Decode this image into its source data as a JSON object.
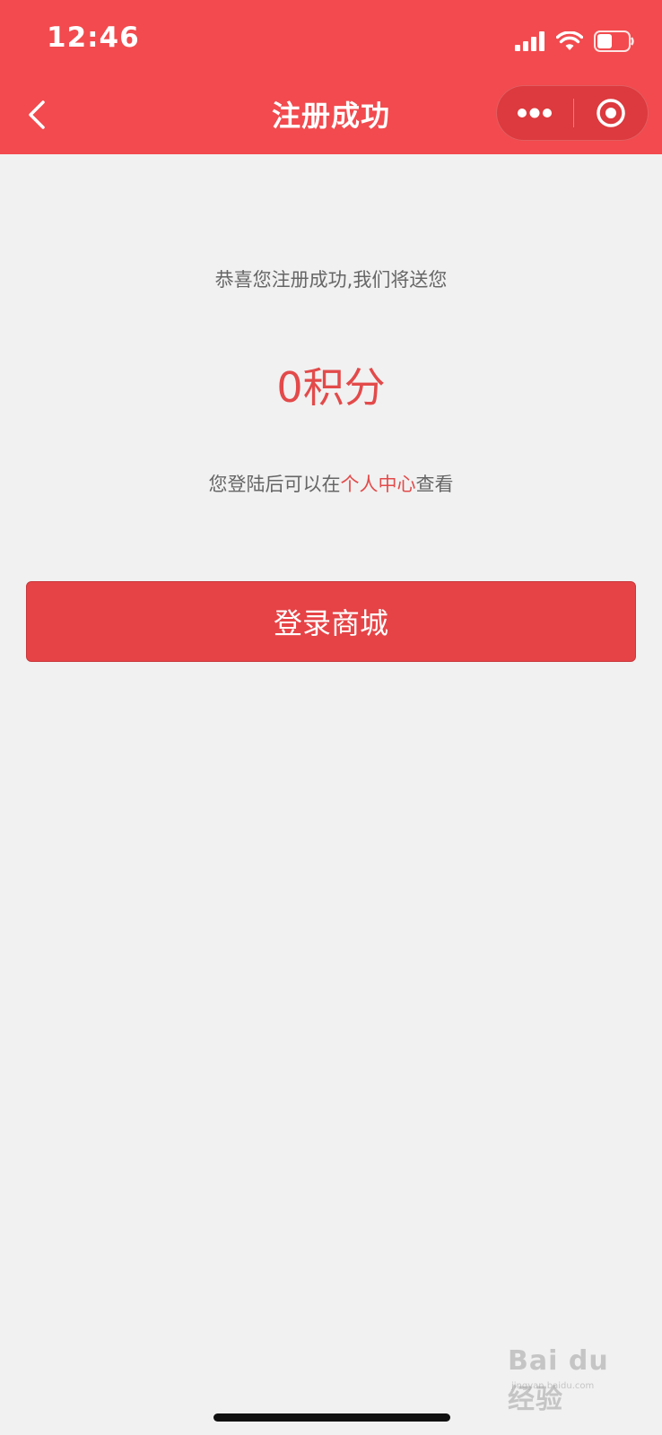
{
  "status_bar": {
    "time": "12:46"
  },
  "nav": {
    "title": "注册成功",
    "back_icon": "chevron-left-icon",
    "more_icon": "more-dots-icon",
    "close_icon": "target-close-icon"
  },
  "content": {
    "message_line1": "恭喜您注册成功,我们将送您",
    "points": "0积分",
    "message_line2_prefix": "您登陆后可以在",
    "message_line2_link": "个人中心",
    "message_line2_suffix": "查看"
  },
  "button": {
    "login_label": "登录商城"
  },
  "watermark": {
    "brand": "Bai du 经验",
    "url": "jingyan.baidu.com"
  },
  "colors": {
    "header_bg": "#f24a4e",
    "accent_red": "#e34a4a",
    "button_bg": "#e64346",
    "page_bg": "#f1f1f1",
    "body_text": "#666666"
  }
}
